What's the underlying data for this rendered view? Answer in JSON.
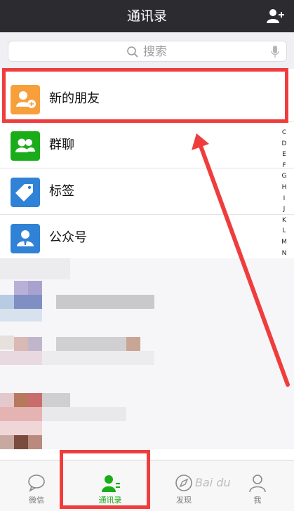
{
  "header": {
    "title": "通讯录",
    "add_icon": "add-contact-icon"
  },
  "search": {
    "placeholder": "搜索",
    "search_icon": "search-icon",
    "mic_icon": "microphone-icon"
  },
  "contacts": {
    "items": [
      {
        "label": "新的朋友",
        "icon": "new-friend-icon",
        "color": "#f7a03b"
      },
      {
        "label": "群聊",
        "icon": "group-chat-icon",
        "color": "#1aad19"
      },
      {
        "label": "标签",
        "icon": "tag-icon",
        "color": "#2f82d6"
      },
      {
        "label": "公众号",
        "icon": "official-account-icon",
        "color": "#2f82d6"
      }
    ]
  },
  "index_letters": [
    "C",
    "D",
    "E",
    "F",
    "G",
    "H",
    "I",
    "J",
    "K",
    "L",
    "M",
    "N"
  ],
  "tabs": [
    {
      "label": "微信",
      "icon": "chat-icon",
      "active": false
    },
    {
      "label": "通讯录",
      "icon": "contacts-icon",
      "active": true,
      "color": "#1aad19"
    },
    {
      "label": "发现",
      "icon": "compass-icon",
      "active": false
    },
    {
      "label": "我",
      "icon": "me-icon",
      "active": false
    }
  ],
  "annotation": {
    "color": "#ef3d3d"
  },
  "watermark": {
    "text": "Bai du"
  }
}
